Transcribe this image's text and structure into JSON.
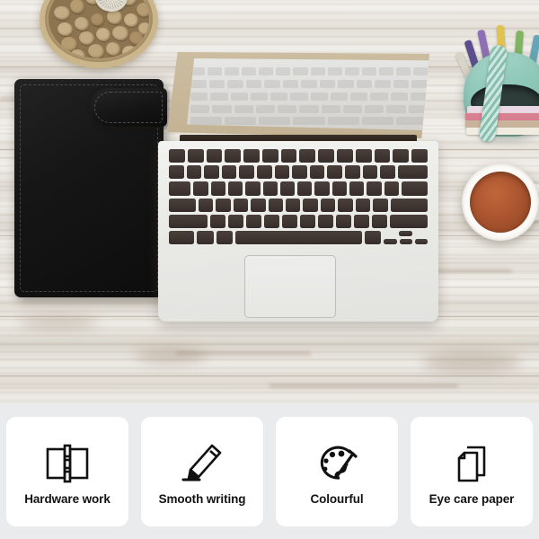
{
  "photo": {
    "scene_description": "Flat-lay overhead photo of a workspace on whitewashed distressed wood",
    "objects": [
      {
        "name": "bowl-of-nuts",
        "description": "Light wooden bowl filled with tan nuts and a small white succulent"
      },
      {
        "name": "black-leather-notebook",
        "description": "Black leather A5 binder notebook with stitched edges and rounded magnetic flap clasp"
      },
      {
        "name": "laptop",
        "description": "Silver laptop, open, screen tilted back showing faint keyboard reflection"
      },
      {
        "name": "pencil-pouch",
        "description": "Mint green pencil case holding coloured pencils and notebooks"
      },
      {
        "name": "coffee-mug",
        "description": "White mug of reddish-brown tea seen from above"
      }
    ],
    "colors": {
      "wood": "#e0dbd3",
      "notebook": "#141414",
      "laptop_body": "#eaeae7",
      "laptop_keys": "#3a302c",
      "pouch": "#8cc6b6",
      "mug": "#fbfaf7",
      "tea": "#ab5530"
    },
    "laptop_keyboard": {
      "rows": [
        {
          "name": "function-row",
          "keys": [
            1,
            1,
            1,
            1,
            1,
            1,
            1,
            1,
            1,
            1,
            1,
            1,
            1,
            1
          ]
        },
        {
          "name": "number-row",
          "keys": [
            1,
            1,
            1,
            1,
            1,
            1,
            1,
            1,
            1,
            1,
            1,
            1,
            1,
            2
          ]
        },
        {
          "name": "qwerty-row",
          "keys": [
            1.5,
            1,
            1,
            1,
            1,
            1,
            1,
            1,
            1,
            1,
            1,
            1,
            1,
            1.8
          ]
        },
        {
          "name": "home-row",
          "keys": [
            1.8,
            1,
            1,
            1,
            1,
            1,
            1,
            1,
            1,
            1,
            1,
            1,
            2.5
          ]
        },
        {
          "name": "zxcv-row",
          "keys": [
            2.5,
            1,
            1,
            1,
            1,
            1,
            1,
            1,
            1,
            1,
            1,
            2.5
          ]
        },
        {
          "name": "space-row",
          "keys": [
            1.5,
            1.2,
            1.2,
            7.5,
            1.2,
            1.2
          ]
        }
      ]
    }
  },
  "features": {
    "background": "#e9ebec",
    "card_background": "#ffffff",
    "items": [
      {
        "icon": "notebook-binder-icon",
        "label": "Hardware work"
      },
      {
        "icon": "pencil-icon",
        "label": "Smooth writing"
      },
      {
        "icon": "paint-palette-icon",
        "label": "Colourful"
      },
      {
        "icon": "paper-sheets-icon",
        "label": "Eye care paper"
      }
    ]
  }
}
